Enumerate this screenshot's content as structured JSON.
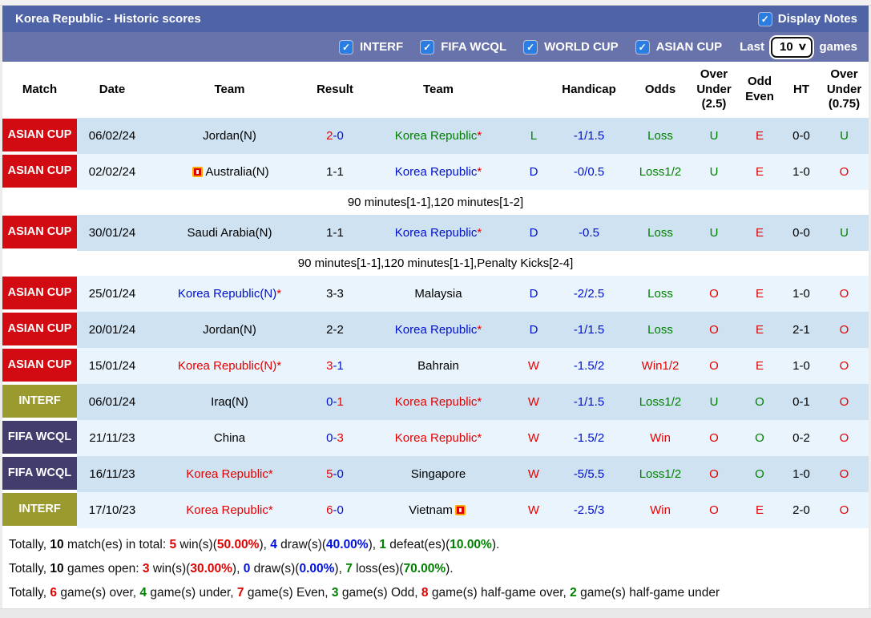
{
  "icons": {
    "check": "✓",
    "chevron_down": "∨"
  },
  "title_bar": {
    "title": "Korea Republic - Historic scores",
    "display_notes_label": "Display Notes",
    "display_notes_checked": true
  },
  "filter_bar": {
    "competitions": [
      {
        "label": "INTERF",
        "checked": true
      },
      {
        "label": "FIFA WCQL",
        "checked": true
      },
      {
        "label": "WORLD CUP",
        "checked": true
      },
      {
        "label": "ASIAN CUP",
        "checked": true
      }
    ],
    "last_label": "Last",
    "last_value": "10",
    "games_label": "games"
  },
  "table": {
    "headers": [
      "Match",
      "Date",
      "Team",
      "Result",
      "Team",
      "",
      "Handicap",
      "Odds",
      "Over Under (2.5)",
      "Odd Even",
      "HT",
      "Over Under (0.75)"
    ]
  },
  "badge_colors": {
    "ASIAN CUP": "#d20a12",
    "INTERF": "#9a9a2e",
    "FIFA WCQL": "#423d6d"
  },
  "matches": [
    {
      "comp": "ASIAN CUP",
      "comp_color": "#d20a12",
      "date": "06/02/24",
      "home": {
        "name": "Jordan(N)",
        "c": "black"
      },
      "result": [
        {
          "t": "2",
          "c": "red"
        },
        {
          "t": "-",
          "c": "blue"
        },
        {
          "t": "0",
          "c": "blue"
        }
      ],
      "away": {
        "name": "Korea Republic",
        "c": "green",
        "star": "*"
      },
      "letter": "L",
      "letter_c": "green",
      "handicap": "-1/1.5",
      "odds": "Loss",
      "odds_c": "green",
      "ou25": "U",
      "ou25_c": "green",
      "oddeven": "E",
      "oddeven_c": "red",
      "ht": "0-0",
      "ou075": "U",
      "ou075_c": "green"
    },
    {
      "comp": "ASIAN CUP",
      "comp_color": "#d20a12",
      "date": "02/02/24",
      "home": {
        "name": "Australia(N)",
        "c": "black",
        "icon": "before"
      },
      "result": [
        {
          "t": "1",
          "c": "black"
        },
        {
          "t": "-",
          "c": "black"
        },
        {
          "t": "1",
          "c": "black"
        }
      ],
      "away": {
        "name": "Korea Republic",
        "c": "blue",
        "star": "*"
      },
      "letter": "D",
      "letter_c": "blue",
      "handicap": "-0/0.5",
      "odds": "Loss1/2",
      "odds_c": "green",
      "ou25": "U",
      "ou25_c": "green",
      "oddeven": "E",
      "oddeven_c": "red",
      "ht": "1-0",
      "ou075": "O",
      "ou075_c": "red",
      "note": "90 minutes[1-1],120 minutes[1-2]"
    },
    {
      "comp": "ASIAN CUP",
      "comp_color": "#d20a12",
      "date": "30/01/24",
      "home": {
        "name": "Saudi Arabia(N)",
        "c": "black"
      },
      "result": [
        {
          "t": "1",
          "c": "black"
        },
        {
          "t": "-",
          "c": "black"
        },
        {
          "t": "1",
          "c": "black"
        }
      ],
      "away": {
        "name": "Korea Republic",
        "c": "blue",
        "star": "*"
      },
      "letter": "D",
      "letter_c": "blue",
      "handicap": "-0.5",
      "odds": "Loss",
      "odds_c": "green",
      "ou25": "U",
      "ou25_c": "green",
      "oddeven": "E",
      "oddeven_c": "red",
      "ht": "0-0",
      "ou075": "U",
      "ou075_c": "green",
      "note": "90 minutes[1-1],120 minutes[1-1],Penalty Kicks[2-4]"
    },
    {
      "comp": "ASIAN CUP",
      "comp_color": "#d20a12",
      "date": "25/01/24",
      "home": {
        "name": "Korea Republic(N)",
        "c": "blue",
        "star": "*"
      },
      "result": [
        {
          "t": "3",
          "c": "black"
        },
        {
          "t": "-",
          "c": "black"
        },
        {
          "t": "3",
          "c": "black"
        }
      ],
      "away": {
        "name": "Malaysia",
        "c": "black"
      },
      "letter": "D",
      "letter_c": "blue",
      "handicap": "-2/2.5",
      "odds": "Loss",
      "odds_c": "green",
      "ou25": "O",
      "ou25_c": "red",
      "oddeven": "E",
      "oddeven_c": "red",
      "ht": "1-0",
      "ou075": "O",
      "ou075_c": "red"
    },
    {
      "comp": "ASIAN CUP",
      "comp_color": "#d20a12",
      "date": "20/01/24",
      "home": {
        "name": "Jordan(N)",
        "c": "black"
      },
      "result": [
        {
          "t": "2",
          "c": "black"
        },
        {
          "t": "-",
          "c": "black"
        },
        {
          "t": "2",
          "c": "black"
        }
      ],
      "away": {
        "name": "Korea Republic",
        "c": "blue",
        "star": "*"
      },
      "letter": "D",
      "letter_c": "blue",
      "handicap": "-1/1.5",
      "odds": "Loss",
      "odds_c": "green",
      "ou25": "O",
      "ou25_c": "red",
      "oddeven": "E",
      "oddeven_c": "red",
      "ht": "2-1",
      "ou075": "O",
      "ou075_c": "red"
    },
    {
      "comp": "ASIAN CUP",
      "comp_color": "#d20a12",
      "date": "15/01/24",
      "home": {
        "name": "Korea Republic(N)",
        "c": "red",
        "star": "*"
      },
      "result": [
        {
          "t": "3",
          "c": "red"
        },
        {
          "t": "-",
          "c": "blue"
        },
        {
          "t": "1",
          "c": "blue"
        }
      ],
      "away": {
        "name": "Bahrain",
        "c": "black"
      },
      "letter": "W",
      "letter_c": "red",
      "handicap": "-1.5/2",
      "odds": "Win1/2",
      "odds_c": "red",
      "ou25": "O",
      "ou25_c": "red",
      "oddeven": "E",
      "oddeven_c": "red",
      "ht": "1-0",
      "ou075": "O",
      "ou075_c": "red"
    },
    {
      "comp": "INTERF",
      "comp_color": "#9a9a2e",
      "date": "06/01/24",
      "home": {
        "name": "Iraq(N)",
        "c": "black"
      },
      "result": [
        {
          "t": "0",
          "c": "blue"
        },
        {
          "t": "-",
          "c": "blue"
        },
        {
          "t": "1",
          "c": "red"
        }
      ],
      "away": {
        "name": "Korea Republic",
        "c": "red",
        "star": "*"
      },
      "letter": "W",
      "letter_c": "red",
      "handicap": "-1/1.5",
      "odds": "Loss1/2",
      "odds_c": "green",
      "ou25": "U",
      "ou25_c": "green",
      "oddeven": "O",
      "oddeven_c": "green",
      "ht": "0-1",
      "ou075": "O",
      "ou075_c": "red"
    },
    {
      "comp": "FIFA WCQL",
      "comp_color": "#423d6d",
      "date": "21/11/23",
      "home": {
        "name": "China",
        "c": "black"
      },
      "result": [
        {
          "t": "0",
          "c": "blue"
        },
        {
          "t": "-",
          "c": "blue"
        },
        {
          "t": "3",
          "c": "red"
        }
      ],
      "away": {
        "name": "Korea Republic",
        "c": "red",
        "star": "*"
      },
      "letter": "W",
      "letter_c": "red",
      "handicap": "-1.5/2",
      "odds": "Win",
      "odds_c": "red",
      "ou25": "O",
      "ou25_c": "red",
      "oddeven": "O",
      "oddeven_c": "green",
      "ht": "0-2",
      "ou075": "O",
      "ou075_c": "red"
    },
    {
      "comp": "FIFA WCQL",
      "comp_color": "#423d6d",
      "date": "16/11/23",
      "home": {
        "name": "Korea Republic",
        "c": "red",
        "star": "*"
      },
      "result": [
        {
          "t": "5",
          "c": "red"
        },
        {
          "t": "-",
          "c": "blue"
        },
        {
          "t": "0",
          "c": "blue"
        }
      ],
      "away": {
        "name": "Singapore",
        "c": "black"
      },
      "letter": "W",
      "letter_c": "red",
      "handicap": "-5/5.5",
      "odds": "Loss1/2",
      "odds_c": "green",
      "ou25": "O",
      "ou25_c": "red",
      "oddeven": "O",
      "oddeven_c": "green",
      "ht": "1-0",
      "ou075": "O",
      "ou075_c": "red"
    },
    {
      "comp": "INTERF",
      "comp_color": "#9a9a2e",
      "date": "17/10/23",
      "home": {
        "name": "Korea Republic",
        "c": "red",
        "star": "*"
      },
      "result": [
        {
          "t": "6",
          "c": "red"
        },
        {
          "t": "-",
          "c": "blue"
        },
        {
          "t": "0",
          "c": "blue"
        }
      ],
      "away": {
        "name": "Vietnam",
        "c": "black",
        "icon": "after"
      },
      "letter": "W",
      "letter_c": "red",
      "handicap": "-2.5/3",
      "odds": "Win",
      "odds_c": "red",
      "ou25": "O",
      "ou25_c": "red",
      "oddeven": "E",
      "oddeven_c": "red",
      "ht": "2-0",
      "ou075": "O",
      "ou075_c": "red"
    }
  ],
  "summary": [
    [
      {
        "t": "Totally, ",
        "c": "plain"
      },
      {
        "t": "10",
        "c": "num"
      },
      {
        "t": " match(es) in total: ",
        "c": "plain"
      },
      {
        "t": "5",
        "c": "red"
      },
      {
        "t": " win(s)(",
        "c": "plain"
      },
      {
        "t": "50.00%",
        "c": "red"
      },
      {
        "t": "), ",
        "c": "plain"
      },
      {
        "t": "4",
        "c": "blue"
      },
      {
        "t": " draw(s)(",
        "c": "plain"
      },
      {
        "t": "40.00%",
        "c": "blue"
      },
      {
        "t": "), ",
        "c": "plain"
      },
      {
        "t": "1",
        "c": "green"
      },
      {
        "t": " defeat(es)(",
        "c": "plain"
      },
      {
        "t": "10.00%",
        "c": "green"
      },
      {
        "t": ").",
        "c": "plain"
      }
    ],
    [
      {
        "t": "Totally, ",
        "c": "plain"
      },
      {
        "t": "10",
        "c": "num"
      },
      {
        "t": " games open: ",
        "c": "plain"
      },
      {
        "t": "3",
        "c": "red"
      },
      {
        "t": " win(s)(",
        "c": "plain"
      },
      {
        "t": "30.00%",
        "c": "red"
      },
      {
        "t": "), ",
        "c": "plain"
      },
      {
        "t": "0",
        "c": "blue"
      },
      {
        "t": " draw(s)(",
        "c": "plain"
      },
      {
        "t": "0.00%",
        "c": "blue"
      },
      {
        "t": "), ",
        "c": "plain"
      },
      {
        "t": "7",
        "c": "green"
      },
      {
        "t": " loss(es)(",
        "c": "plain"
      },
      {
        "t": "70.00%",
        "c": "green"
      },
      {
        "t": ").",
        "c": "plain"
      }
    ],
    [
      {
        "t": "Totally, ",
        "c": "plain"
      },
      {
        "t": "6",
        "c": "red"
      },
      {
        "t": " game(s) over, ",
        "c": "plain"
      },
      {
        "t": "4",
        "c": "green"
      },
      {
        "t": " game(s) under, ",
        "c": "plain"
      },
      {
        "t": "7",
        "c": "red"
      },
      {
        "t": " game(s) Even, ",
        "c": "plain"
      },
      {
        "t": "3",
        "c": "green"
      },
      {
        "t": " game(s) Odd, ",
        "c": "plain"
      },
      {
        "t": "8",
        "c": "red"
      },
      {
        "t": " game(s) half-game over, ",
        "c": "plain"
      },
      {
        "t": "2",
        "c": "green"
      },
      {
        "t": " game(s) half-game under",
        "c": "plain"
      }
    ]
  ]
}
